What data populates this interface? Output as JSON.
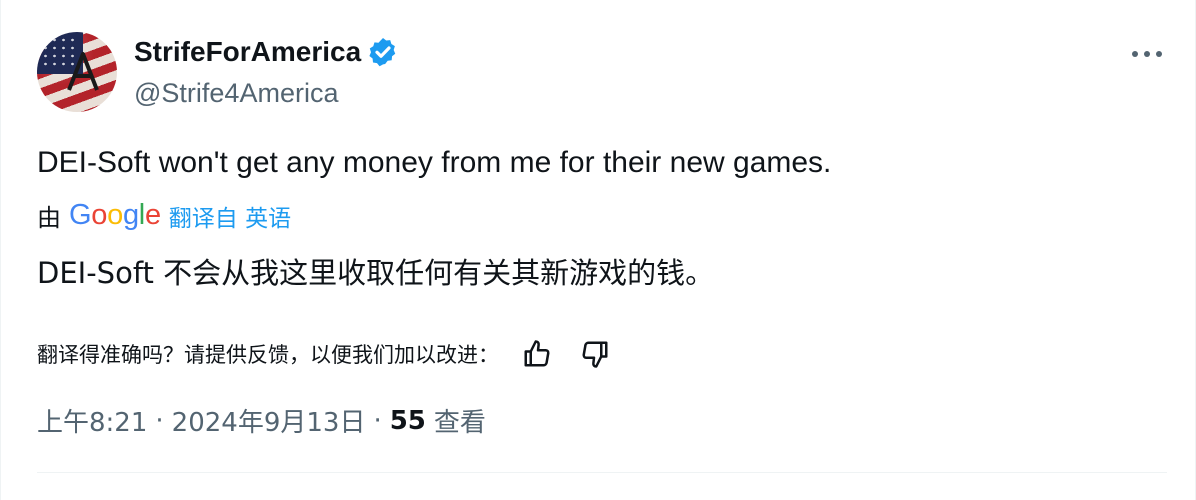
{
  "author": {
    "display_name": "StrifeForAmerica",
    "handle": "@Strife4America",
    "verified": true,
    "avatar_icon": "american-flag-avatar"
  },
  "tweet": {
    "text": "DEI-Soft won't get any money from me for their new games.",
    "translation": {
      "by_label": "由",
      "provider": "Google",
      "link_label": "翻译自 英语",
      "text": "DEI-Soft 不会从我这里收取任何有关其新游戏的钱。"
    },
    "feedback": {
      "question": "翻译得准确吗？请提供反馈，以便我们加以改进："
    },
    "time": "上午8:21",
    "separator": "·",
    "date": "2024年9月13日",
    "views_count": "55",
    "views_label": "查看"
  },
  "colors": {
    "accent": "#1d9bf0",
    "text_primary": "#0f1419",
    "text_secondary": "#536471",
    "divider": "#eff3f4"
  },
  "icons": {
    "verified": "verified-badge-icon",
    "more": "more-dots-icon",
    "thumbs_up": "thumbs-up-icon",
    "thumbs_down": "thumbs-down-icon"
  }
}
